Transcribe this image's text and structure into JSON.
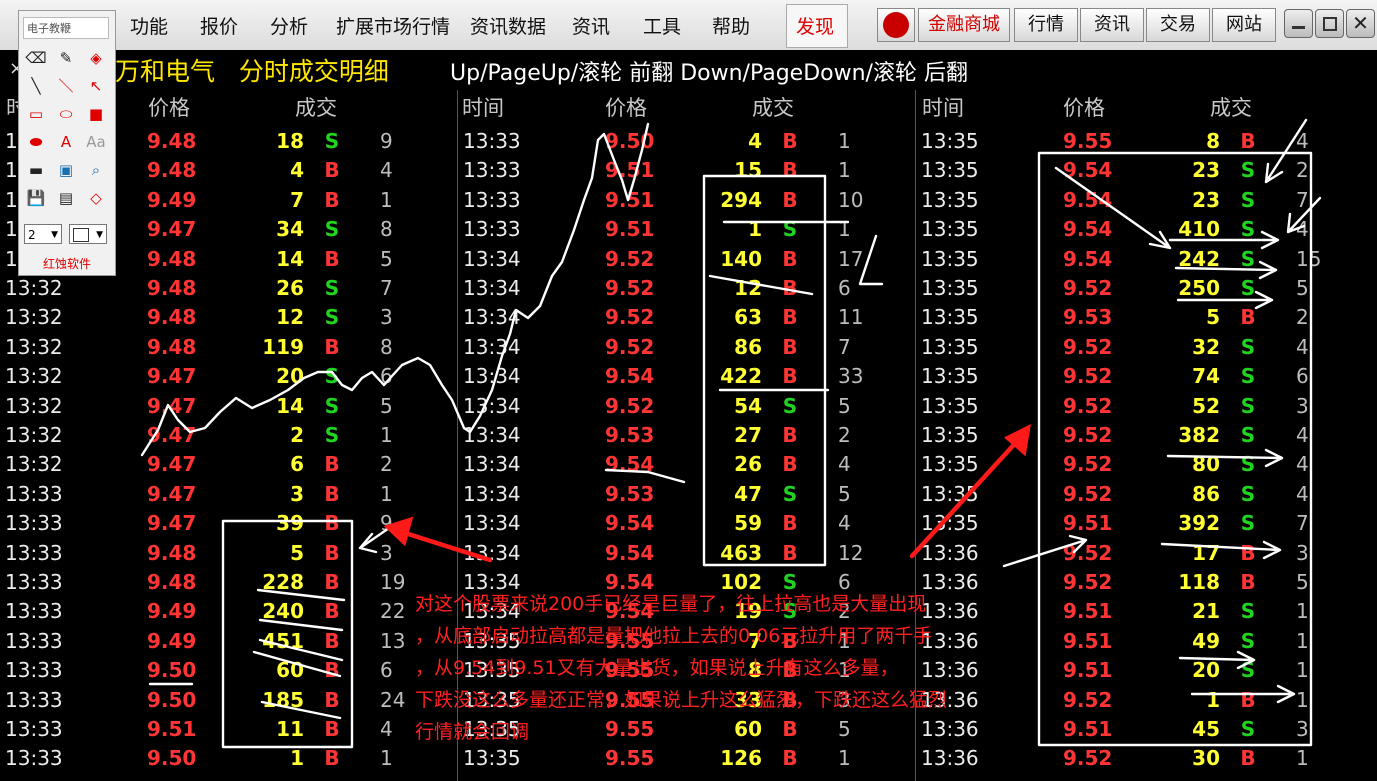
{
  "menu": {
    "items": [
      "功能",
      "报价",
      "分析",
      "扩展市场行情",
      "资讯数据",
      "资讯",
      "工具",
      "帮助"
    ],
    "discover": "发现",
    "right_buttons": [
      "金融商城",
      "行情",
      "资讯",
      "交易",
      "网站"
    ]
  },
  "title": {
    "stock": "万和电气",
    "view": "分时成交明细",
    "nav_hint": "Up/PageUp/滚轮 前翻 Down/PageDown/滚轮 后翻",
    "close": "×"
  },
  "headers": {
    "time": "时间",
    "price": "价格",
    "volume": "成交"
  },
  "columns": [
    {
      "rows": [
        [
          "13:31",
          "9.48",
          "18",
          "S",
          "9"
        ],
        [
          "13:31",
          "9.48",
          "4",
          "B",
          "4"
        ],
        [
          "13:31",
          "9.49",
          "7",
          "B",
          "1"
        ],
        [
          "13:31",
          "9.47",
          "34",
          "S",
          "8"
        ],
        [
          "13:31",
          "9.48",
          "14",
          "B",
          "5"
        ],
        [
          "13:32",
          "9.48",
          "26",
          "S",
          "7"
        ],
        [
          "13:32",
          "9.48",
          "12",
          "S",
          "3"
        ],
        [
          "13:32",
          "9.48",
          "119",
          "B",
          "8"
        ],
        [
          "13:32",
          "9.47",
          "20",
          "S",
          "6"
        ],
        [
          "13:32",
          "9.47",
          "14",
          "S",
          "5"
        ],
        [
          "13:32",
          "9.47",
          "2",
          "S",
          "1"
        ],
        [
          "13:32",
          "9.47",
          "6",
          "B",
          "2"
        ],
        [
          "13:33",
          "9.47",
          "3",
          "B",
          "1"
        ],
        [
          "13:33",
          "9.47",
          "39",
          "B",
          "9"
        ],
        [
          "13:33",
          "9.48",
          "5",
          "B",
          "3"
        ],
        [
          "13:33",
          "9.48",
          "228",
          "B",
          "19"
        ],
        [
          "13:33",
          "9.49",
          "240",
          "B",
          "22"
        ],
        [
          "13:33",
          "9.49",
          "451",
          "B",
          "13"
        ],
        [
          "13:33",
          "9.50",
          "60",
          "B",
          "6"
        ],
        [
          "13:33",
          "9.50",
          "185",
          "B",
          "24"
        ],
        [
          "13:33",
          "9.51",
          "11",
          "B",
          "4"
        ],
        [
          "13:33",
          "9.50",
          "1",
          "B",
          "1"
        ]
      ]
    },
    {
      "rows": [
        [
          "13:33",
          "9.50",
          "4",
          "B",
          "1"
        ],
        [
          "13:33",
          "9.51",
          "15",
          "B",
          "1"
        ],
        [
          "13:33",
          "9.51",
          "294",
          "B",
          "10"
        ],
        [
          "13:33",
          "9.51",
          "1",
          "S",
          "1"
        ],
        [
          "13:34",
          "9.52",
          "140",
          "B",
          "17"
        ],
        [
          "13:34",
          "9.52",
          "12",
          "B",
          "6"
        ],
        [
          "13:34",
          "9.52",
          "63",
          "B",
          "11"
        ],
        [
          "13:34",
          "9.52",
          "86",
          "B",
          "7"
        ],
        [
          "13:34",
          "9.54",
          "422",
          "B",
          "33"
        ],
        [
          "13:34",
          "9.52",
          "54",
          "S",
          "5"
        ],
        [
          "13:34",
          "9.53",
          "27",
          "B",
          "2"
        ],
        [
          "13:34",
          "9.54",
          "26",
          "B",
          "4"
        ],
        [
          "13:34",
          "9.53",
          "47",
          "S",
          "5"
        ],
        [
          "13:34",
          "9.54",
          "59",
          "B",
          "4"
        ],
        [
          "13:34",
          "9.54",
          "463",
          "B",
          "12"
        ],
        [
          "13:34",
          "9.54",
          "102",
          "S",
          "6"
        ],
        [
          "13:34",
          "9.54",
          "19",
          "S",
          "2"
        ],
        [
          "13:35",
          "9.55",
          "7",
          "B",
          "1"
        ],
        [
          "13:35",
          "9.55",
          "8",
          "B",
          "1"
        ],
        [
          "13:35",
          "9.55",
          "33",
          "B",
          "3"
        ],
        [
          "13:35",
          "9.55",
          "60",
          "B",
          "5"
        ],
        [
          "13:35",
          "9.55",
          "126",
          "B",
          "1"
        ]
      ]
    },
    {
      "rows": [
        [
          "13:35",
          "9.55",
          "8",
          "B",
          "4"
        ],
        [
          "13:35",
          "9.54",
          "23",
          "S",
          "2"
        ],
        [
          "13:35",
          "9.54",
          "23",
          "S",
          "7"
        ],
        [
          "13:35",
          "9.54",
          "410",
          "S",
          "4"
        ],
        [
          "13:35",
          "9.54",
          "242",
          "S",
          "15"
        ],
        [
          "13:35",
          "9.52",
          "250",
          "S",
          "5"
        ],
        [
          "13:35",
          "9.53",
          "5",
          "B",
          "2"
        ],
        [
          "13:35",
          "9.52",
          "32",
          "S",
          "4"
        ],
        [
          "13:35",
          "9.52",
          "74",
          "S",
          "6"
        ],
        [
          "13:35",
          "9.52",
          "52",
          "S",
          "3"
        ],
        [
          "13:35",
          "9.52",
          "382",
          "S",
          "4"
        ],
        [
          "13:35",
          "9.52",
          "80",
          "S",
          "4"
        ],
        [
          "13:35",
          "9.52",
          "86",
          "S",
          "4"
        ],
        [
          "13:35",
          "9.51",
          "392",
          "S",
          "7"
        ],
        [
          "13:36",
          "9.52",
          "17",
          "B",
          "3"
        ],
        [
          "13:36",
          "9.52",
          "118",
          "B",
          "5"
        ],
        [
          "13:36",
          "9.51",
          "21",
          "S",
          "1"
        ],
        [
          "13:36",
          "9.51",
          "49",
          "S",
          "1"
        ],
        [
          "13:36",
          "9.51",
          "20",
          "S",
          "1"
        ],
        [
          "13:36",
          "9.52",
          "1",
          "B",
          "1"
        ],
        [
          "13:36",
          "9.51",
          "45",
          "S",
          "3"
        ],
        [
          "13:36",
          "9.52",
          "30",
          "B",
          "1"
        ]
      ]
    }
  ],
  "toolbox": {
    "title": "电子教鞭",
    "brand": "红蚀软件",
    "width_value": "2",
    "tools": [
      "eraser-icon",
      "pen-icon",
      "fill-icon",
      "brush-icon",
      "line-icon",
      "arrow-icon",
      "rect-icon",
      "ellipse-icon",
      "filled-rect-icon",
      "filled-ellipse-icon",
      "text-icon",
      "font-size-icon",
      "black-bar-icon",
      "screen-icon",
      "zoom-icon",
      "save-icon",
      "open-icon",
      "shape-icon"
    ]
  },
  "annotation": {
    "lines": [
      "对这个股票来说200手已经是巨量了，往上拉高也是大量出现",
      "，从底部启动拉高都是量把他拉上去的0.06元拉升用了两千手",
      "，从9.54到9.51又有大量出货，如果说上升有这么多量，",
      "下跌没这么多量还正常，如果说上升这么猛烈，下跌还这么猛烈",
      "行情就会回调"
    ]
  }
}
